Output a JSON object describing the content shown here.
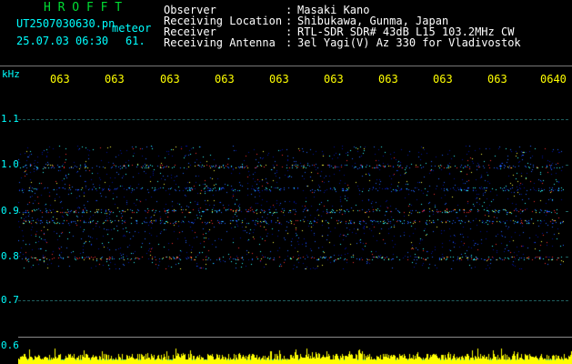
{
  "app": {
    "name": "H R O F F T",
    "file": "UT2507030630.pn",
    "mode": "meteor",
    "datetime": "25.07.03 06:30",
    "count": "61."
  },
  "info": [
    {
      "label": "Observer",
      "sep": ":",
      "value": "Masaki Kano"
    },
    {
      "label": "Receiving Location",
      "sep": ":",
      "value": "Shibukawa, Gunma, Japan"
    },
    {
      "label": "Receiver",
      "sep": ":",
      "value": "RTL-SDR SDR# 43dB L15 103.2MHz CW"
    },
    {
      "label": "Receiving Antenna",
      "sep": ":",
      "value": "3el Yagi(V) Az 330 for Vladivostok"
    }
  ],
  "time_axis": [
    "063",
    "063",
    "063",
    "063",
    "063",
    "063",
    "063",
    "063",
    "063",
    "0640"
  ],
  "freq_axis": {
    "unit": "kHz",
    "ticks": [
      "1.1",
      "1.0",
      "0.9",
      "0.8",
      "0.7",
      "0.6"
    ]
  },
  "colors": {
    "background": "#000000",
    "header_text": "#ffffff",
    "axis_text": "#00ffff",
    "time_text": "#ffff00",
    "title_text": "#00dd33",
    "signal_low": "#0000aa",
    "signal_mid": "#00ffff",
    "signal_high": "#ff0000",
    "level_bar": "#ffff00"
  }
}
